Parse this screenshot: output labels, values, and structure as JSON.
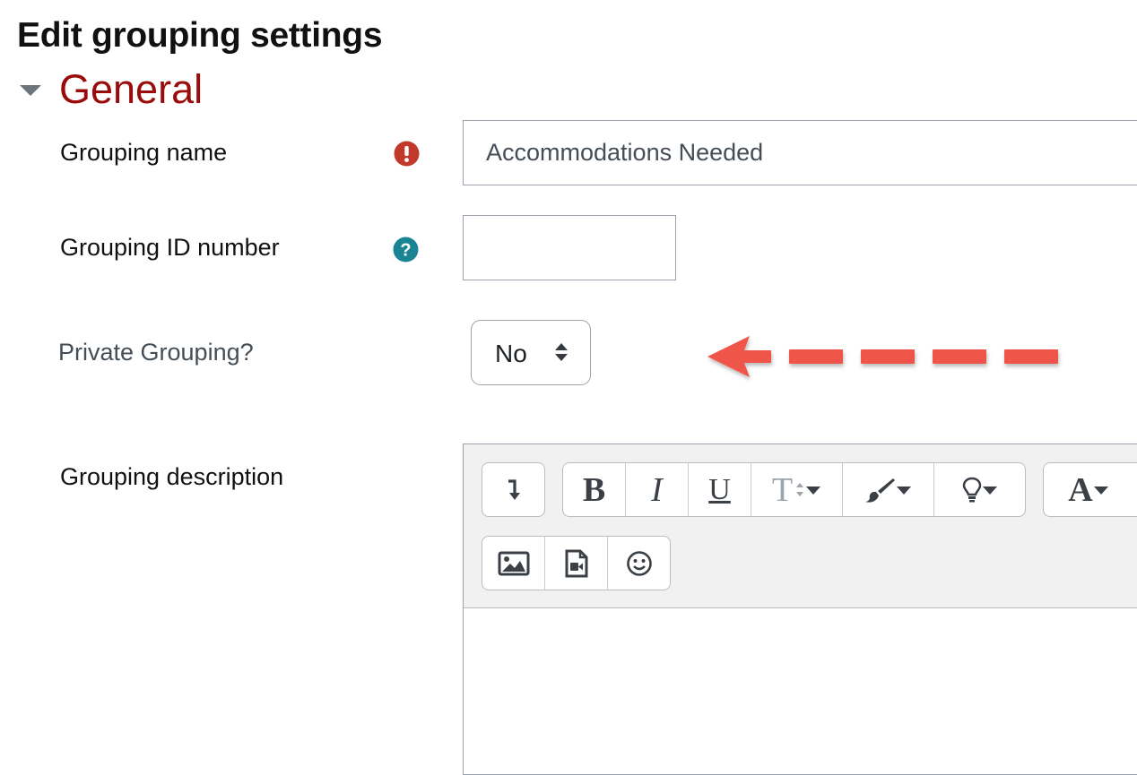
{
  "page": {
    "title": "Edit grouping settings"
  },
  "section": {
    "title": "General",
    "toggle_icon": "triangle-down-icon"
  },
  "fields": {
    "grouping_name": {
      "label": "Grouping name",
      "value": "Accommodations Needed",
      "badge_icon": "required-exclamation-icon"
    },
    "grouping_id": {
      "label": "Grouping ID number",
      "value": "",
      "badge_icon": "help-question-icon"
    },
    "private_grouping": {
      "label": "Private Grouping?",
      "selected": "No"
    },
    "description": {
      "label": "Grouping description"
    }
  },
  "editor": {
    "toolbar_row1": [
      {
        "name": "show-more-buttons",
        "icon": "arrow-turn-down-icon"
      },
      {
        "name": "bold",
        "glyph": "B"
      },
      {
        "name": "italic",
        "glyph": "I"
      },
      {
        "name": "underline",
        "glyph": "U"
      },
      {
        "name": "font-size",
        "glyph": "T",
        "icon": "text-size-dropdown-icon"
      },
      {
        "name": "paragraph-style",
        "icon": "paintbrush-dropdown-icon"
      },
      {
        "name": "help-tips",
        "icon": "lightbulb-dropdown-icon"
      },
      {
        "name": "font-color",
        "glyph": "A",
        "icon": "font-color-dropdown-icon"
      }
    ],
    "toolbar_row2": [
      {
        "name": "insert-image",
        "icon": "image-icon"
      },
      {
        "name": "insert-media",
        "icon": "video-file-icon"
      },
      {
        "name": "insert-emoji",
        "icon": "smiley-icon"
      }
    ]
  },
  "colors": {
    "section_title": "#9a0c0c",
    "required_badge": "#c0392b",
    "help_badge": "#1a8394",
    "annotation_arrow": "#f0544a"
  }
}
